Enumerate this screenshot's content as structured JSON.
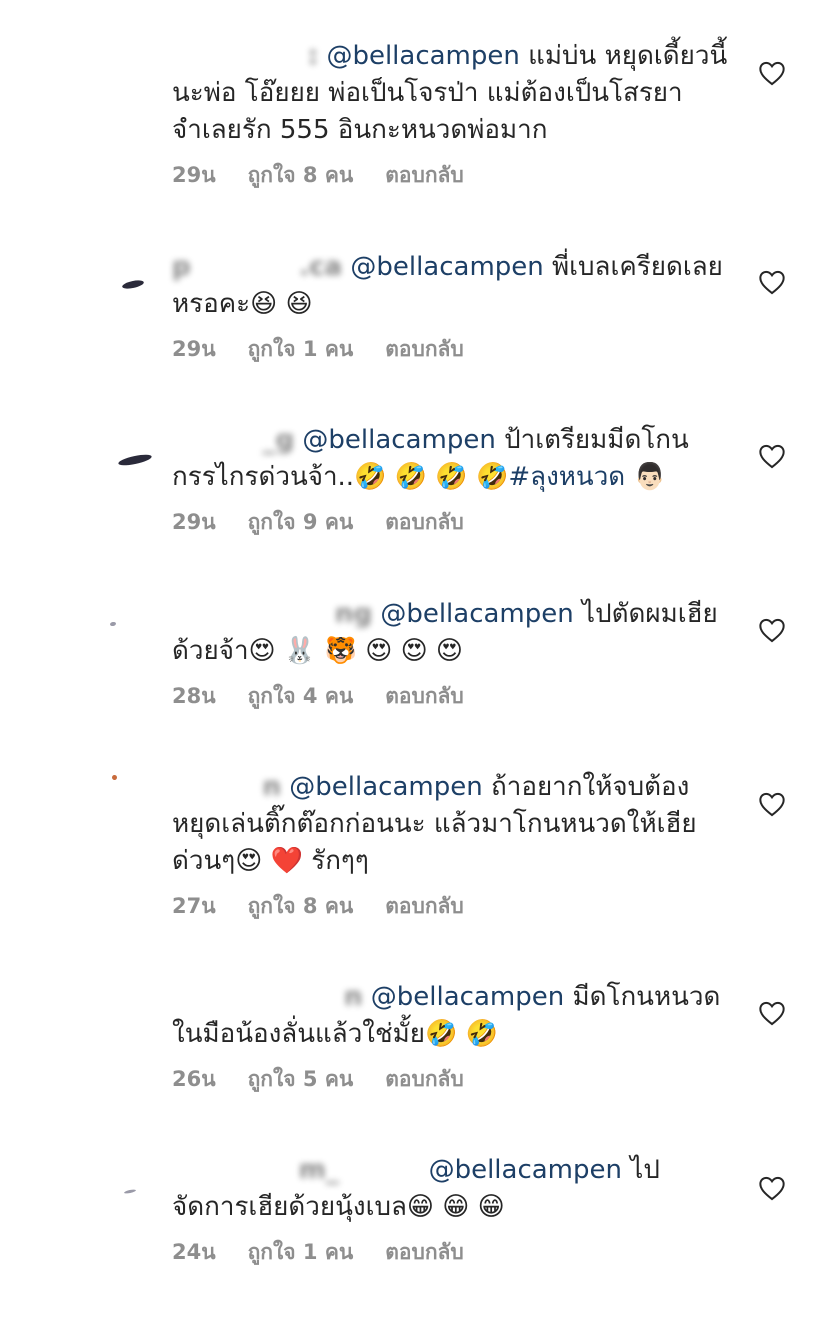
{
  "comments": [
    {
      "user": "               :",
      "mention": "@bellacampen",
      "text": " แม่บ่น หยุดเดี้ยวนี้นะพ่อ โอ๊ยยย พ่อเป็นโจรป่า แม่ต้องเป็นโสรยา จำเลยรัก 555 อินกะหนวดพ่อมาก",
      "time": "29น",
      "likes": "ถูกใจ 8 คน",
      "reply": "ตอบกลับ"
    },
    {
      "user": "p            .ca",
      "mention": "@bellacampen",
      "text": " พี่เบลเครียดเลยหรอคะ😆 😆",
      "time": "29น",
      "likes": "ถูกใจ 1 คน",
      "reply": "ตอบกลับ"
    },
    {
      "user": "          _g",
      "mention": "@bellacampen",
      "text": " ป้าเตรียมมีดโกนกรรไกรด่วนจ้า..🤣 🤣 🤣 🤣",
      "hashtag": "#ลุงหนวด",
      "tail": " 👨🏻",
      "time": "29น",
      "likes": "ถูกใจ 9 คน",
      "reply": "ตอบกลับ"
    },
    {
      "user": "                  ng",
      "mention": "@bellacampen",
      "text": " ไปตัดผมเฮียด้วยจ้า😍 🐰 🐯 😍 😍 😍",
      "time": "28น",
      "likes": "ถูกใจ 4 คน",
      "reply": "ตอบกลับ"
    },
    {
      "user": "          n",
      "mention": "@bellacampen",
      "text": " ถ้าอยากให้จบต้องหยุดเล่นติ๊กต๊อกก่อนนะ แล้วมาโกนหนวดให้เฮียด่วนๆ😍 ❤️ รักๆๆ",
      "time": "27น",
      "likes": "ถูกใจ 8 คน",
      "reply": "ตอบกลับ"
    },
    {
      "user": "                   n",
      "mention": "@bellacampen",
      "text": " มีดโกนหนวดในมือน้องลั่นแล้วใช่มั้ย🤣 🤣",
      "time": "26น",
      "likes": "ถูกใจ 5 คน",
      "reply": "ตอบกลับ"
    },
    {
      "user": "              m_         ",
      "mention": "@bellacampen",
      "text": " ไปจัดการเฮียด้วยนุ้งเบล😁 😁 😁",
      "time": "24น",
      "likes": "ถูกใจ 1 คน",
      "reply": "ตอบกลับ"
    }
  ],
  "icons": {
    "like": "heart-outline-icon",
    "avatar": "user-avatar"
  },
  "colors": {
    "mention": "#1d3f66",
    "meta": "#8e8e8e",
    "text": "#262626"
  }
}
